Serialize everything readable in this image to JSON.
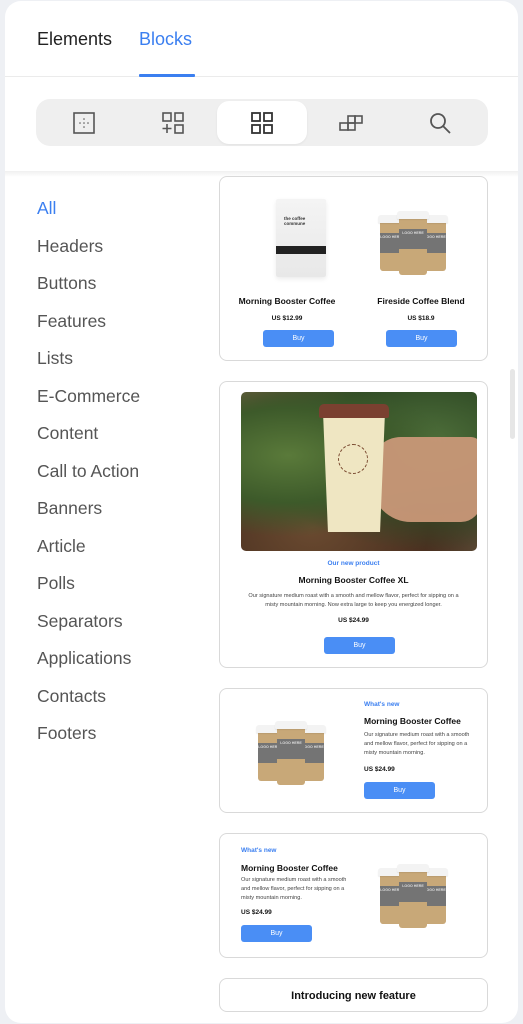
{
  "tabs": [
    {
      "label": "Elements",
      "active": false
    },
    {
      "label": "Blocks",
      "active": true
    }
  ],
  "toolbar": [
    {
      "icon": "dotted-square-icon",
      "active": false
    },
    {
      "icon": "add-block-icon",
      "active": false
    },
    {
      "icon": "grid-icon",
      "active": true
    },
    {
      "icon": "stacked-blocks-icon",
      "active": false
    },
    {
      "icon": "search-icon",
      "active": false
    }
  ],
  "categories": [
    {
      "label": "All",
      "active": true
    },
    {
      "label": "Headers"
    },
    {
      "label": "Buttons"
    },
    {
      "label": "Features"
    },
    {
      "label": "Lists"
    },
    {
      "label": "E-Commerce"
    },
    {
      "label": "Content"
    },
    {
      "label": "Call to Action"
    },
    {
      "label": "Banners"
    },
    {
      "label": "Article"
    },
    {
      "label": "Polls"
    },
    {
      "label": "Separators"
    },
    {
      "label": "Applications"
    },
    {
      "label": "Contacts"
    },
    {
      "label": "Footers"
    }
  ],
  "blocks": {
    "two_products": {
      "items": [
        {
          "title": "Morning Booster Coffee",
          "price": "US $12.99",
          "button": "Buy",
          "bag_brand": "the coffee commune"
        },
        {
          "title": "Fireside Coffee Blend",
          "price": "US $18.9",
          "button": "Buy"
        }
      ]
    },
    "hero_product": {
      "eyebrow": "Our new product",
      "title": "Morning Booster Coffee XL",
      "description": "Our signature medium roast with a smooth and mellow flavor, perfect for sipping on a misty mountain morning. Now extra large to keep you energized longer.",
      "price": "US $24.99",
      "button": "Buy"
    },
    "image_left": {
      "eyebrow": "What's new",
      "title": "Morning Booster Coffee",
      "description": "Our signature medium roast with a smooth and mellow flavor, perfect for sipping on a misty mountain morning.",
      "price": "US $24.99",
      "button": "Buy"
    },
    "image_right": {
      "eyebrow": "What's new",
      "title": "Morning Booster Coffee",
      "description": "Our signature medium roast with a smooth and mellow flavor, perfect for sipping on a misty mountain morning.",
      "price": "US $24.99",
      "button": "Buy"
    },
    "feature_intro": {
      "title": "Introducing new feature"
    }
  },
  "cup_logo_text": "LOGO HERE",
  "colors": {
    "accent": "#3b7ff0",
    "button": "#4a8ef5"
  }
}
